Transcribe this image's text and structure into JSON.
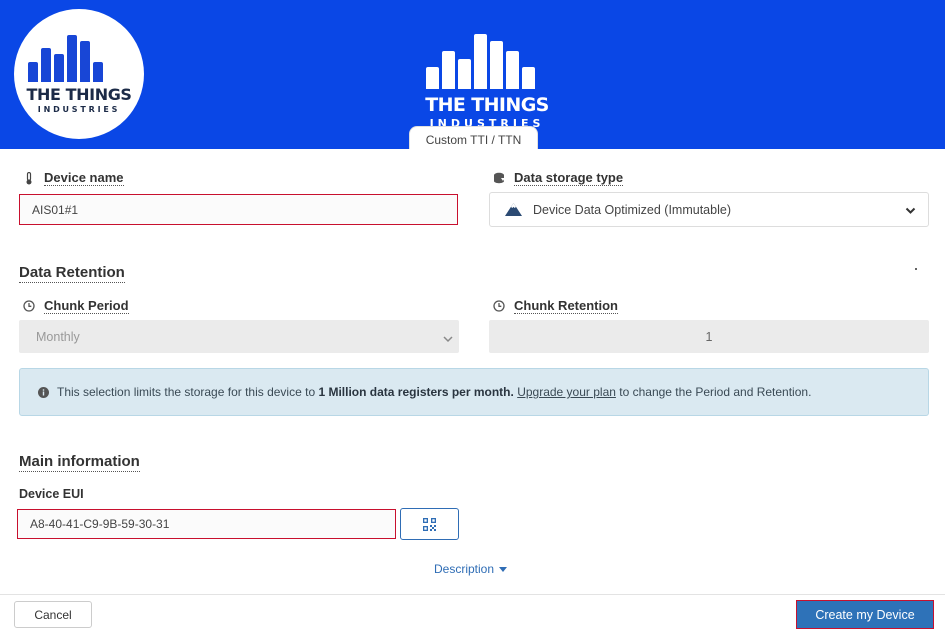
{
  "header": {
    "brand_title": "THE THINGS",
    "brand_subtitle": "INDUSTRIES",
    "tab_label": "Custom TTI / TTN",
    "accent_color": "#0a47e6"
  },
  "form": {
    "device_name": {
      "label": "Device name",
      "value": "AIS01#1",
      "icon": "thermometer-icon"
    },
    "storage_type": {
      "label": "Data storage type",
      "value": "Device Data Optimized (Immutable)",
      "icon": "database-icon"
    },
    "retention": {
      "section_title": "Data Retention",
      "chunk_period": {
        "label": "Chunk Period",
        "value": "Monthly",
        "icon": "clock-icon"
      },
      "chunk_retention": {
        "label": "Chunk Retention",
        "value": "1",
        "icon": "clock-icon"
      }
    },
    "alert": {
      "text_before": "This selection limits the storage for this device to",
      "bold": "1 Million data registers per month.",
      "link": "Upgrade your plan",
      "text_after": "to change the Period and Retention."
    },
    "main_info": {
      "section_title": "Main information",
      "device_eui_label": "Device EUI",
      "device_eui_value": "A8-40-41-C9-9B-59-30-31"
    },
    "description_link": "Description"
  },
  "footer": {
    "cancel_label": "Cancel",
    "create_label": "Create my Device"
  }
}
